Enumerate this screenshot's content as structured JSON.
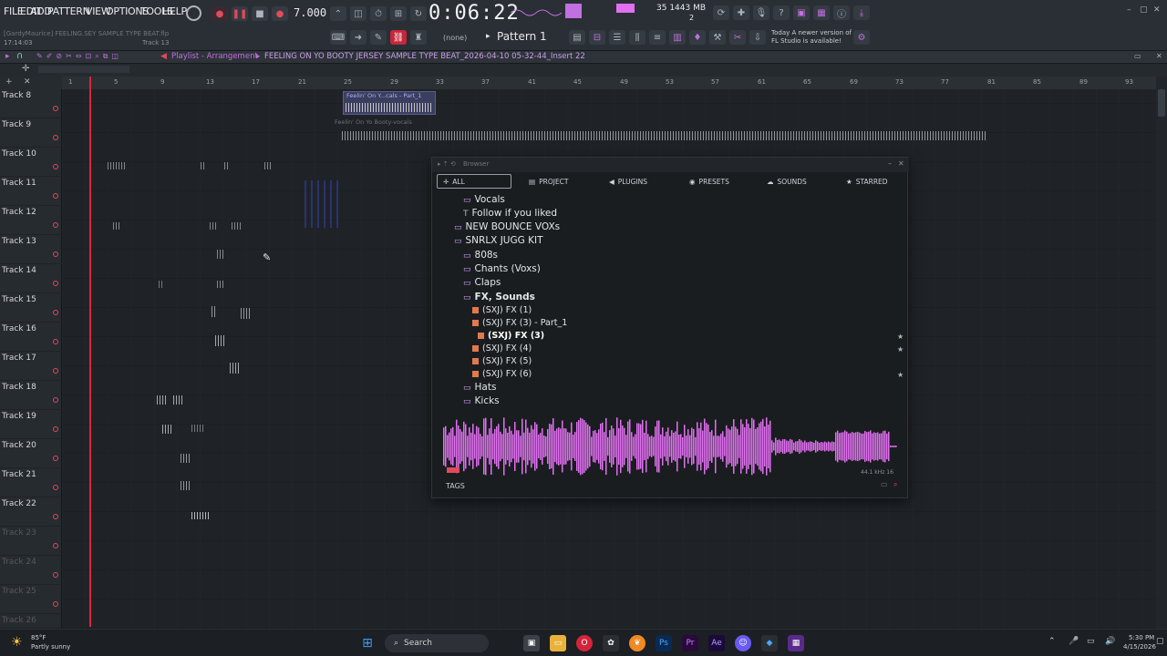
{
  "menu": [
    "FILE",
    "EDIT",
    "ADD",
    "PATTERN",
    "VIEW",
    "OPTIONS",
    "TOOLS",
    "HELP"
  ],
  "project_line": "[GardyMaurice] FEELING.SEY SAMPLE TYPE BEAT.flp",
  "clock_small": "17:14:03",
  "track_hint": "Track 13",
  "tempo": "7.000",
  "time_display": "0:06:22",
  "cpu_mem": "35  1443 MB",
  "cpu_sub": "2",
  "none_label": "(none)",
  "pattern_label": "Pattern 1",
  "news_line1": "Today  A newer version of",
  "news_line2": "FL Studio is available!",
  "playlist_title": "Playlist - Arrangement",
  "playlist_path": "FEELING ON YO BOOTY JERSEY SAMPLE TYPE BEAT_2026-04-10 05-32-44_Insert 22",
  "ruler": [
    "1",
    "5",
    "9",
    "13",
    "17",
    "21",
    "25",
    "29",
    "33",
    "37",
    "41",
    "45",
    "49",
    "53",
    "57",
    "61",
    "65",
    "69",
    "73",
    "77",
    "81",
    "85",
    "89",
    "93"
  ],
  "tracks": [
    "Track 8",
    "Track 9",
    "Track 10",
    "Track 11",
    "Track 12",
    "Track 13",
    "Track 14",
    "Track 15",
    "Track 16",
    "Track 17",
    "Track 18",
    "Track 19",
    "Track 20",
    "Track 21",
    "Track 22",
    "Track 23",
    "Track 24",
    "Track 25",
    "Track 26"
  ],
  "clips": {
    "clip1": "Feelin' On Y...cals - Part_1",
    "clip2": "Feelin' On Yo Booty-vocals"
  },
  "browser": {
    "title": "Browser",
    "tabs": [
      "ALL",
      "PROJECT",
      "PLUGINS",
      "PRESETS",
      "SOUNDS",
      "STARRED"
    ],
    "items": [
      {
        "label": "Vocals",
        "type": "folder"
      },
      {
        "label": "Follow if you liked",
        "type": "text"
      },
      {
        "label": "NEW BOUNCE VOXs",
        "type": "folder"
      },
      {
        "label": "SNRLX JUGG KIT",
        "type": "folder"
      },
      {
        "label": "808s",
        "type": "folder"
      },
      {
        "label": "Chants (Voxs)",
        "type": "folder"
      },
      {
        "label": "Claps",
        "type": "folder"
      },
      {
        "label": "FX, Sounds",
        "type": "folder"
      },
      {
        "label": "(SXJ) FX (1)",
        "type": "file"
      },
      {
        "label": "(SXJ) FX (3) - Part_1",
        "type": "file"
      },
      {
        "label": "(SXJ) FX (3)",
        "type": "file"
      },
      {
        "label": "(SXJ) FX (4)",
        "type": "file"
      },
      {
        "label": "(SXJ) FX (5)",
        "type": "file"
      },
      {
        "label": "(SXJ) FX (6)",
        "type": "file"
      },
      {
        "label": "Hats",
        "type": "folder"
      },
      {
        "label": "Kicks",
        "type": "folder"
      }
    ],
    "sample_info": "44.1 kHz 16",
    "tags_label": "TAGS",
    "wave_color": "#e070f0"
  },
  "taskbar": {
    "weather_temp": "85°F",
    "weather_desc": "Partly sunny",
    "search": "Search",
    "time": "5:30 PM",
    "date": "4/15/2026"
  },
  "colors": {
    "playhead": "#d9263a",
    "accent": "#e04a5a",
    "wave": "#e070f0"
  }
}
